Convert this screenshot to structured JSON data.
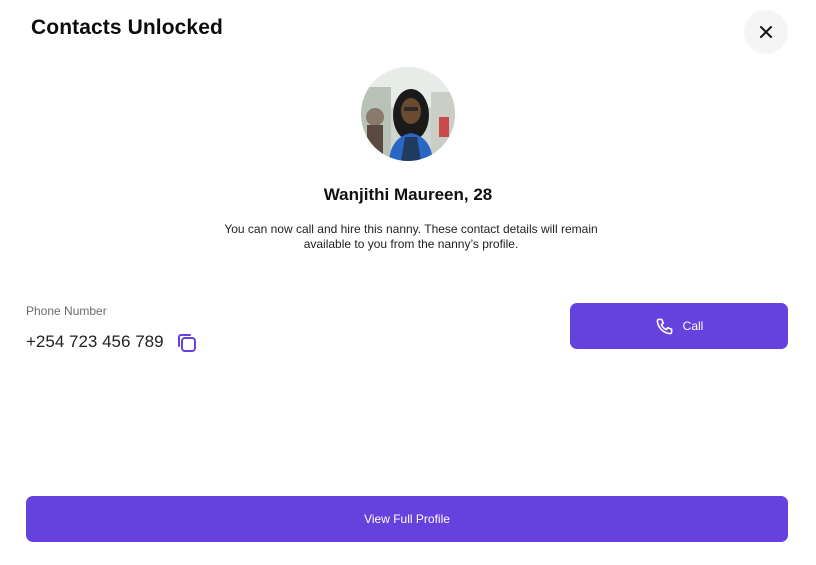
{
  "modal": {
    "title": "Contacts Unlocked",
    "close_icon": "close-icon"
  },
  "profile": {
    "name": "Wanjithi Maureen, 28",
    "description": "You can now call and hire this nanny. These contact details will remain available to you from the nanny’s profile."
  },
  "contact": {
    "phone_label": "Phone Number",
    "phone_number": "+254 723 456 789",
    "copy_icon": "copy-icon"
  },
  "actions": {
    "call_label": "Call",
    "call_icon": "phone-icon",
    "view_profile_label": "View Full Profile"
  },
  "colors": {
    "accent": "#6741dd",
    "close_bg": "#f5f5f5"
  }
}
